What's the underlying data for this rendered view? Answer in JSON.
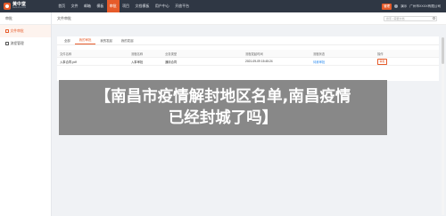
{
  "brand": {
    "title": "黄中堂",
    "sub": "www.xxx.com"
  },
  "nav": {
    "items": [
      "首页",
      "文件",
      "邮箱",
      "模板",
      "审批",
      "项目",
      "文档模板",
      "用户中心",
      "开放平台"
    ],
    "active_index": 4,
    "badge": "管理",
    "user": "演示",
    "company": "广州市XXXX有限公司"
  },
  "sidebar": {
    "header": "审批",
    "items": [
      {
        "label": "文件审批",
        "active": true
      },
      {
        "label": "流程管理",
        "active": false
      }
    ]
  },
  "main": {
    "title": "文件审批",
    "search_placeholder": "搜索 | 需要文档",
    "tabs": [
      "全部",
      "我的审批",
      "我的发起",
      "我的发起"
    ],
    "active_tab": 1,
    "columns": [
      "文件名称",
      "流程名称",
      "业务类型",
      "流程发起时间",
      "流程状态",
      "操作"
    ],
    "rows": [
      {
        "file": "入事合同.pdf",
        "flow": "入事审批",
        "type": "通用合同",
        "time": "2021-09-09 15:45:24",
        "status": "待我审批",
        "action": "审批"
      }
    ]
  },
  "banner": {
    "line1": "【南昌市疫情解封地区名单,南昌疫情",
    "line2": "已经封城了吗】"
  },
  "colors": {
    "accent": "#e65b2a",
    "nav_bg": "#2f3744",
    "link": "#2d8cf0",
    "banner_bg": "#828282"
  }
}
